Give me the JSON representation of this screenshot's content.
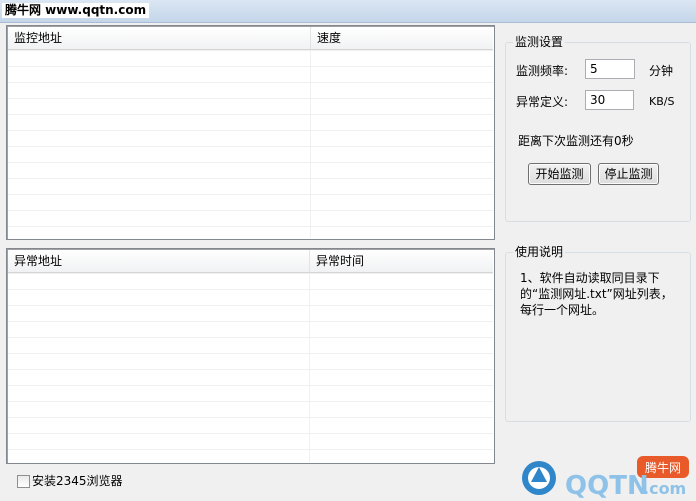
{
  "watermark": "腾牛网 www.qqtn.com",
  "monitor_list": {
    "columns": [
      "监控地址",
      "速度"
    ],
    "rows": []
  },
  "abnormal_list": {
    "columns": [
      "异常地址",
      "异常时间"
    ],
    "rows": []
  },
  "settings": {
    "title": "监测设置",
    "frequency_label": "监测频率:",
    "frequency_value": "5",
    "frequency_unit": "分钟",
    "threshold_label": "异常定义:",
    "threshold_value": "30",
    "threshold_unit": "KB/S",
    "countdown_text": "距离下次监测还有0秒",
    "start_button": "开始监测",
    "stop_button": "停止监测"
  },
  "usage": {
    "title": "使用说明",
    "text": "1、软件自动读取同目录下的“监测网址.txt”网址列表，每行一个网址。"
  },
  "install_checkbox": {
    "label": "安装2345浏览器",
    "checked": false
  },
  "logo": {
    "text": "QQTN",
    "domain": ".com",
    "badge": "腾牛网"
  }
}
